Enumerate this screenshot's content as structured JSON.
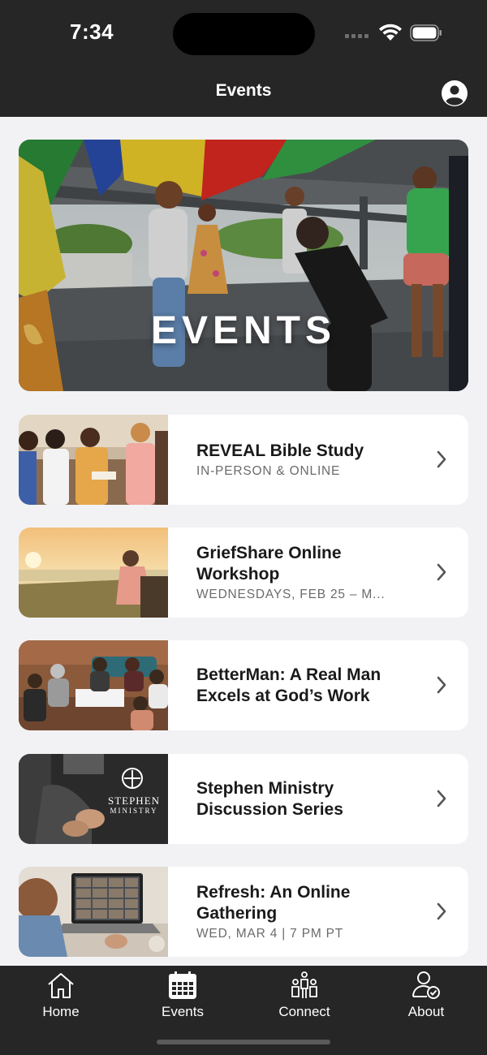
{
  "status_bar": {
    "time": "7:34"
  },
  "header": {
    "title": "Events"
  },
  "hero": {
    "text": "EVENTS"
  },
  "events": [
    {
      "title": "REVEAL Bible Study",
      "subtitle": "IN-PERSON & ONLINE"
    },
    {
      "title": "GriefShare Online Workshop",
      "subtitle": "WEDNESDAYS, FEB 25 – M..."
    },
    {
      "title": "BetterMan: A Real Man Excels at God’s Work",
      "subtitle": ""
    },
    {
      "title": "Stephen Ministry Discussion Series",
      "subtitle": ""
    },
    {
      "title": "Refresh: An Online Gathering",
      "subtitle": "WED, MAR 4 | 7 PM PT"
    }
  ],
  "stephen_logo": {
    "line1": "STEPHEN",
    "line2": "MINISTRY"
  },
  "tabs": [
    {
      "label": "Home",
      "icon": "home-icon"
    },
    {
      "label": "Events",
      "icon": "calendar-icon"
    },
    {
      "label": "Connect",
      "icon": "people-icon"
    },
    {
      "label": "About",
      "icon": "person-check-icon"
    }
  ],
  "colors": {
    "bar": "#262626",
    "background": "#f2f2f5",
    "card": "#ffffff"
  }
}
